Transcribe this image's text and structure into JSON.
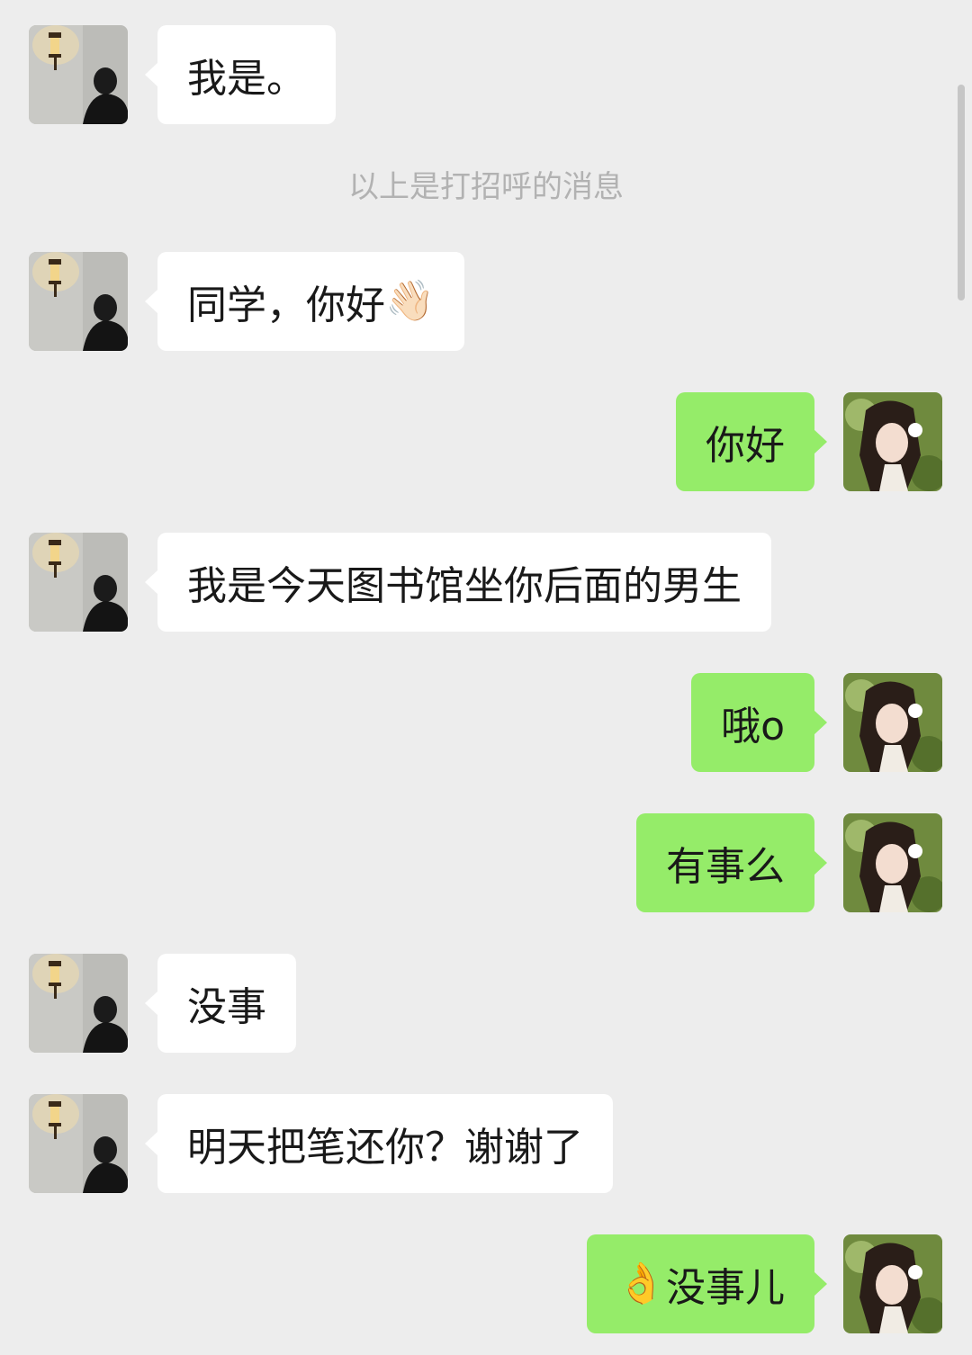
{
  "system_note": "以上是打招呼的消息",
  "messages": [
    {
      "side": "left",
      "text": "我是。",
      "emoji": ""
    },
    {
      "side": "left",
      "text": "同学，你好",
      "emoji": "👋🏻"
    },
    {
      "side": "right",
      "text": "你好",
      "emoji": ""
    },
    {
      "side": "left",
      "text": "我是今天图书馆坐你后面的男生",
      "emoji": ""
    },
    {
      "side": "right",
      "text": "哦o",
      "emoji": ""
    },
    {
      "side": "right",
      "text": "有事么",
      "emoji": ""
    },
    {
      "side": "left",
      "text": "没事",
      "emoji": ""
    },
    {
      "side": "left",
      "text": "明天把笔还你？谢谢了",
      "emoji": ""
    },
    {
      "side": "right",
      "text": "没事儿",
      "emoji": "👌"
    }
  ],
  "avatars": {
    "contact": "contact-avatar-man-with-lamp",
    "self": "self-avatar-girl-with-flower"
  },
  "colors": {
    "background": "#ededed",
    "incoming_bubble": "#ffffff",
    "outgoing_bubble": "#95ec69",
    "system_text": "#b2b2b2"
  }
}
